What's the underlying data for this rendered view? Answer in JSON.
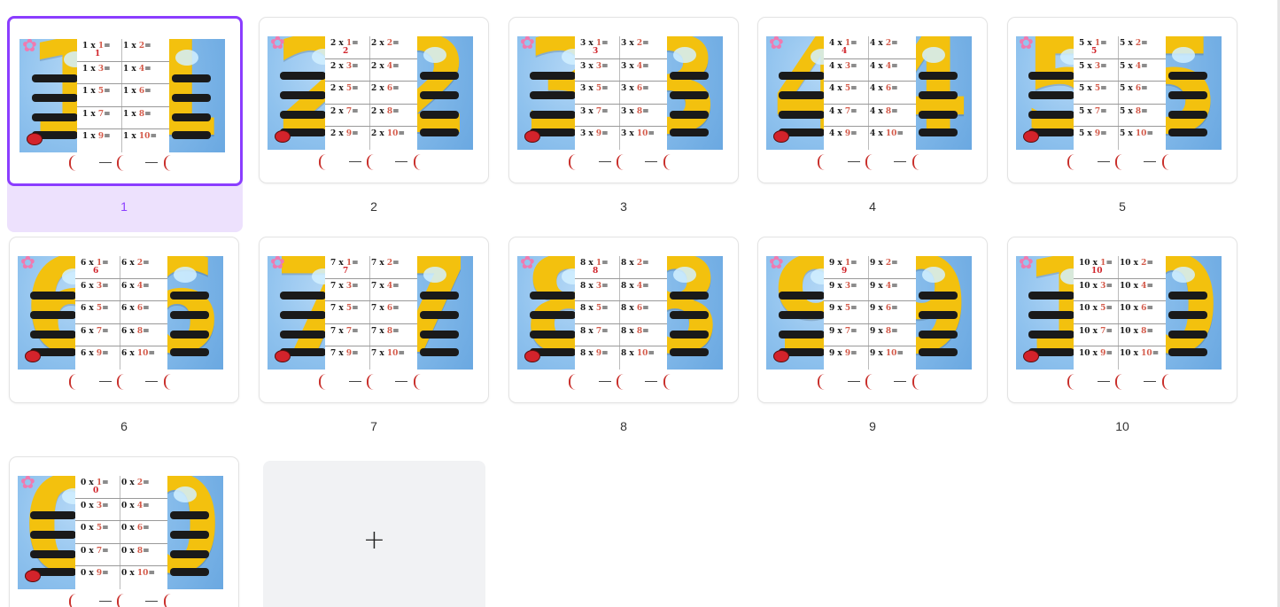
{
  "selected_page": 1,
  "accent_color": "#8b3dff",
  "add_page_icon": "plus-icon",
  "pages": [
    {
      "number": "1",
      "digit": "1",
      "rows": [
        [
          "1 x ",
          "1",
          "=",
          "1 x ",
          "2",
          "="
        ],
        [
          "1 x ",
          "3",
          "=",
          "1 x ",
          "4",
          "="
        ],
        [
          "1 x ",
          "5",
          "=",
          "1 x ",
          "6",
          "="
        ],
        [
          "1 x ",
          "7",
          "=",
          "1 x ",
          "8",
          "="
        ],
        [
          "1 x ",
          "9",
          "=",
          "1 x ",
          "10",
          "="
        ]
      ],
      "answer": "1"
    },
    {
      "number": "2",
      "digit": "2",
      "rows": [
        [
          "2 x ",
          "1",
          "=",
          "2 x ",
          "2",
          "="
        ],
        [
          "2 x ",
          "3",
          "=",
          "2 x ",
          "4",
          "="
        ],
        [
          "2 x ",
          "5",
          "=",
          "2 x ",
          "6",
          "="
        ],
        [
          "2 x ",
          "7",
          "=",
          "2 x ",
          "8",
          "="
        ],
        [
          "2 x ",
          "9",
          "=",
          "2 x ",
          "10",
          "="
        ]
      ],
      "answer": "2"
    },
    {
      "number": "3",
      "digit": "3",
      "rows": [
        [
          "3 x ",
          "1",
          "=",
          "3 x ",
          "2",
          "="
        ],
        [
          "3 x ",
          "3",
          "=",
          "3 x ",
          "4",
          "="
        ],
        [
          "3 x ",
          "5",
          "=",
          "3 x ",
          "6",
          "="
        ],
        [
          "3 x ",
          "7",
          "=",
          "3 x ",
          "8",
          "="
        ],
        [
          "3 x ",
          "9",
          "=",
          "3 x ",
          "10",
          "="
        ]
      ],
      "answer": "3"
    },
    {
      "number": "4",
      "digit": "4",
      "rows": [
        [
          "4 x ",
          "1",
          "=",
          "4 x ",
          "2",
          "="
        ],
        [
          "4 x ",
          "3",
          "=",
          "4 x ",
          "4",
          "="
        ],
        [
          "4 x ",
          "5",
          "=",
          "4 x ",
          "6",
          "="
        ],
        [
          "4 x ",
          "7",
          "=",
          "4 x ",
          "8",
          "="
        ],
        [
          "4 x ",
          "9",
          "=",
          "4 x ",
          "10",
          "="
        ]
      ],
      "answer": "4"
    },
    {
      "number": "5",
      "digit": "5",
      "rows": [
        [
          "5 x ",
          "1",
          "=",
          "5 x ",
          "2",
          "="
        ],
        [
          "5 x ",
          "3",
          "=",
          "5 x ",
          "4",
          "="
        ],
        [
          "5 x ",
          "5",
          "=",
          "5 x ",
          "6",
          "="
        ],
        [
          "5 x ",
          "7",
          "=",
          "5 x ",
          "8",
          "="
        ],
        [
          "5 x ",
          "9",
          "=",
          "5 x ",
          "10",
          "="
        ]
      ],
      "answer": "5"
    },
    {
      "number": "6",
      "digit": "6",
      "rows": [
        [
          "6 x ",
          "1",
          "=",
          "6 x ",
          "2",
          "="
        ],
        [
          "6 x ",
          "3",
          "=",
          "6 x ",
          "4",
          "="
        ],
        [
          "6 x ",
          "5",
          "=",
          "6 x ",
          "6",
          "="
        ],
        [
          "6 x ",
          "7",
          "=",
          "6 x ",
          "8",
          "="
        ],
        [
          "6 x ",
          "9",
          "=",
          "6 x ",
          "10",
          "="
        ]
      ],
      "answer": "6"
    },
    {
      "number": "7",
      "digit": "7",
      "rows": [
        [
          "7 x ",
          "1",
          "=",
          "7 x ",
          "2",
          "="
        ],
        [
          "7 x ",
          "3",
          "=",
          "7 x ",
          "4",
          "="
        ],
        [
          "7 x ",
          "5",
          "=",
          "7 x ",
          "6",
          "="
        ],
        [
          "7 x ",
          "7",
          "=",
          "7 x ",
          "8",
          "="
        ],
        [
          "7 x ",
          "9",
          "=",
          "7 x ",
          "10",
          "="
        ]
      ],
      "answer": "7"
    },
    {
      "number": "8",
      "digit": "8",
      "rows": [
        [
          "8 x ",
          "1",
          "=",
          "8 x ",
          "2",
          "="
        ],
        [
          "8 x ",
          "3",
          "=",
          "8 x ",
          "4",
          "="
        ],
        [
          "8 x ",
          "5",
          "=",
          "8 x ",
          "6",
          "="
        ],
        [
          "8 x ",
          "7",
          "=",
          "8 x ",
          "8",
          "="
        ],
        [
          "8 x ",
          "9",
          "=",
          "8 x ",
          "10",
          "="
        ]
      ],
      "answer": "8"
    },
    {
      "number": "9",
      "digit": "9",
      "rows": [
        [
          "9 x ",
          "1",
          "=",
          "9 x ",
          "2",
          "="
        ],
        [
          "9 x ",
          "3",
          "=",
          "9 x ",
          "4",
          "="
        ],
        [
          "9 x ",
          "5",
          "=",
          "9 x ",
          "6",
          "="
        ],
        [
          "9 x ",
          "7",
          "=",
          "9 x ",
          "8",
          "="
        ],
        [
          "9 x ",
          "9",
          "=",
          "9 x ",
          "10",
          "="
        ]
      ],
      "answer": "9"
    },
    {
      "number": "10",
      "digit": "10",
      "rows": [
        [
          "10 x ",
          "1",
          "=",
          "10 x ",
          "2",
          "="
        ],
        [
          "10 x ",
          "3",
          "=",
          "10 x ",
          "4",
          "="
        ],
        [
          "10 x ",
          "5",
          "=",
          "10 x ",
          "6",
          "="
        ],
        [
          "10 x ",
          "7",
          "=",
          "10 x ",
          "8",
          "="
        ],
        [
          "10 x ",
          "9",
          "=",
          "10 x ",
          "10",
          "="
        ]
      ],
      "answer": "10"
    },
    {
      "number": "",
      "digit": "0",
      "rows": [
        [
          "0 x ",
          "1",
          "=",
          "0 x ",
          "2",
          "="
        ],
        [
          "0 x ",
          "3",
          "=",
          "0 x ",
          "4",
          "="
        ],
        [
          "0 x ",
          "5",
          "=",
          "0 x ",
          "6",
          "="
        ],
        [
          "0 x ",
          "7",
          "=",
          "0 x ",
          "8",
          "="
        ],
        [
          "0 x ",
          "9",
          "=",
          "0 x ",
          "10",
          "="
        ]
      ],
      "answer": "0"
    }
  ]
}
